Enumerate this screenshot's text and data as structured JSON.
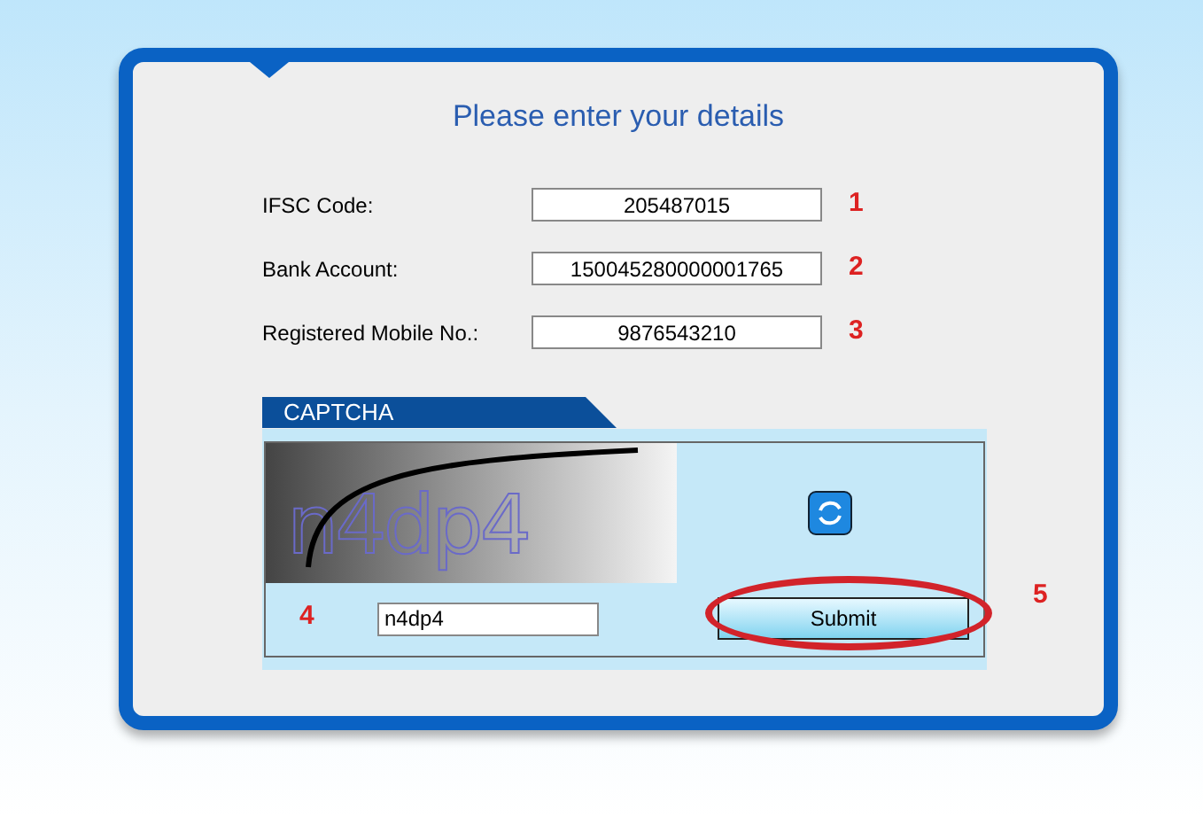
{
  "form": {
    "title": "Please enter your details",
    "fields": [
      {
        "label": "IFSC Code:",
        "value": "205487015",
        "marker": "1"
      },
      {
        "label": "Bank Account:",
        "value": "150045280000001765",
        "marker": "2"
      },
      {
        "label": "Registered Mobile No.:",
        "value": "9876543210",
        "marker": "3"
      }
    ]
  },
  "captcha": {
    "heading": "CAPTCHA",
    "image_text": "n4dp4",
    "value": "n4dp4",
    "marker": "4"
  },
  "submit": {
    "label": "Submit",
    "marker": "5",
    "circled": true
  }
}
